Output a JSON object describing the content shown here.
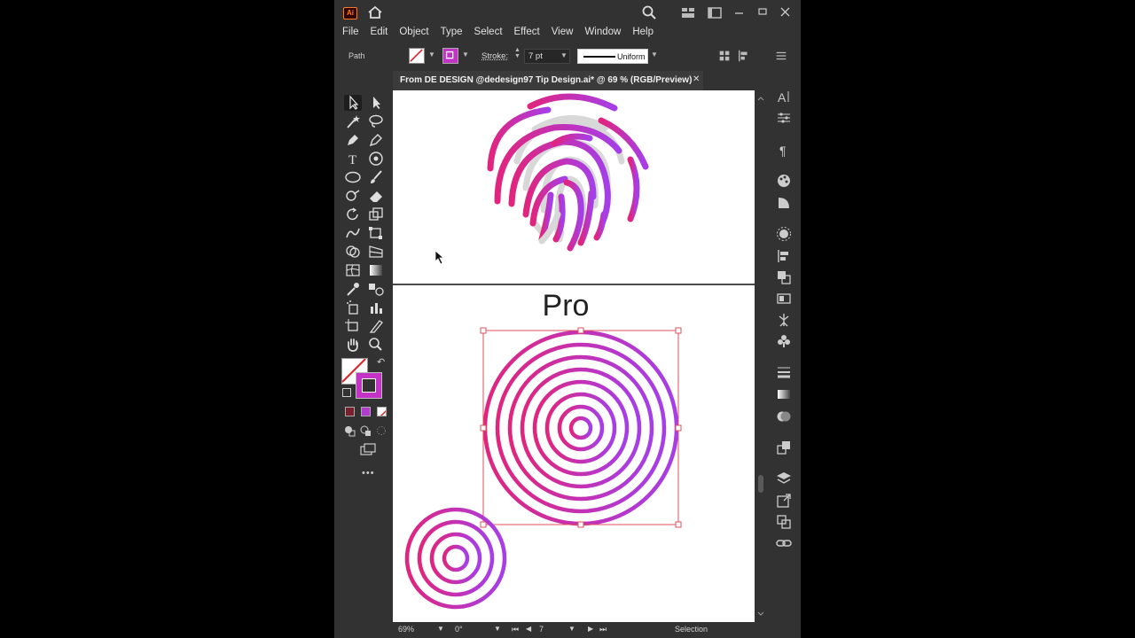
{
  "app": {
    "logo": "Ai",
    "accent": "#ff7b1f"
  },
  "menu": [
    "File",
    "Edit",
    "Object",
    "Type",
    "Select",
    "Effect",
    "View",
    "Window",
    "Help"
  ],
  "control_bar": {
    "selection_type": "Path",
    "stroke_label": "Stroke:",
    "stroke_weight": "7 pt",
    "stroke_profile": "Uniform"
  },
  "document_tab": {
    "title": "From DE DESIGN @dedesign97 Tip Design.ai* @ 69 % (RGB/Preview)",
    "close_glyph": "✕"
  },
  "canvas": {
    "heading": "Pro",
    "gradient": [
      "#e0257e",
      "#a63ee8"
    ]
  },
  "status_bar": {
    "zoom": "69%",
    "rotation": "0°",
    "artboard": "7",
    "tool": "Selection"
  }
}
